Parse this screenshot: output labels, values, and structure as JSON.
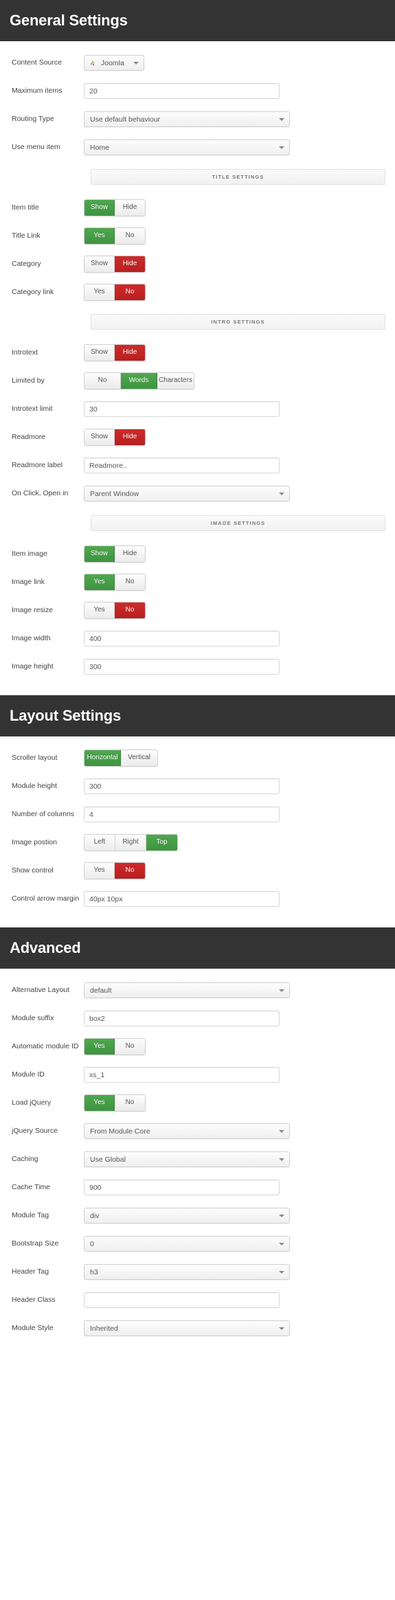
{
  "sections": [
    {
      "title": "General Settings",
      "rows": [
        {
          "kind": "select-joomla",
          "label": "Content Source",
          "value": "Joomla",
          "icon": "joomla-icon",
          "width": "88"
        },
        {
          "kind": "input",
          "label": "Maximum items",
          "value": "20",
          "width": "wide"
        },
        {
          "kind": "select",
          "label": "Routing Type",
          "value": "Use default behaviour",
          "width": "mid"
        },
        {
          "kind": "select",
          "label": "Use menu item",
          "value": "Home",
          "width": "mid"
        },
        {
          "kind": "subhead",
          "label": "TITLE SETTINGS"
        },
        {
          "kind": "toggle",
          "label": "Item title",
          "options": [
            "Show",
            "Hide"
          ],
          "selected": 0,
          "state": "green"
        },
        {
          "kind": "toggle",
          "label": "Title Link",
          "options": [
            "Yes",
            "No"
          ],
          "selected": 0,
          "state": "green"
        },
        {
          "kind": "toggle",
          "label": "Category",
          "options": [
            "Show",
            "Hide"
          ],
          "selected": 1,
          "state": "red"
        },
        {
          "kind": "toggle",
          "label": "Category link",
          "options": [
            "Yes",
            "No"
          ],
          "selected": 1,
          "state": "red"
        },
        {
          "kind": "subhead",
          "label": "INTRO SETTINGS"
        },
        {
          "kind": "toggle",
          "label": "Introtext",
          "options": [
            "Show",
            "Hide"
          ],
          "selected": 1,
          "state": "red"
        },
        {
          "kind": "toggle3",
          "label": "Limited by",
          "options": [
            "No",
            "Words",
            "Characters"
          ],
          "selected": 1,
          "state": "green"
        },
        {
          "kind": "input",
          "label": "Introtext limit",
          "value": "30",
          "width": "wide"
        },
        {
          "kind": "toggle",
          "label": "Readmore",
          "options": [
            "Show",
            "Hide"
          ],
          "selected": 1,
          "state": "red"
        },
        {
          "kind": "input",
          "label": "Readmore label",
          "value": "Readmore..",
          "width": "wide"
        },
        {
          "kind": "select",
          "label": "On Click, Open in",
          "value": "Parent Window",
          "width": "mid"
        },
        {
          "kind": "subhead",
          "label": "IMAGE SETTINGS"
        },
        {
          "kind": "toggle",
          "label": "Item image",
          "options": [
            "Show",
            "Hide"
          ],
          "selected": 0,
          "state": "green"
        },
        {
          "kind": "toggle",
          "label": "Image link",
          "options": [
            "Yes",
            "No"
          ],
          "selected": 0,
          "state": "green"
        },
        {
          "kind": "toggle",
          "label": "Image resize",
          "options": [
            "Yes",
            "No"
          ],
          "selected": 1,
          "state": "red"
        },
        {
          "kind": "input",
          "label": "Image width",
          "value": "400",
          "width": "wide"
        },
        {
          "kind": "input",
          "label": "Image height",
          "value": "300",
          "width": "wide"
        }
      ]
    },
    {
      "title": "Layout Settings",
      "rows": [
        {
          "kind": "toggle2w",
          "label": "Scroller layout",
          "options": [
            "Horizontal",
            "Vertical"
          ],
          "selected": 0,
          "state": "green"
        },
        {
          "kind": "input",
          "label": "Module height",
          "value": "300",
          "width": "wide"
        },
        {
          "kind": "input",
          "label": "Number of columns",
          "value": "4",
          "width": "wide"
        },
        {
          "kind": "toggle3p",
          "label": "Image postion",
          "options": [
            "Left",
            "Right",
            "Top"
          ],
          "selected": 2,
          "state": "green"
        },
        {
          "kind": "toggle",
          "label": "Show control",
          "options": [
            "Yes",
            "No"
          ],
          "selected": 1,
          "state": "red"
        },
        {
          "kind": "input",
          "label": "Control arrow margin",
          "value": "40px 10px",
          "width": "wide"
        }
      ]
    },
    {
      "title": "Advanced",
      "rows": [
        {
          "kind": "select",
          "label": "Alternative Layout",
          "value": "default",
          "width": "mid"
        },
        {
          "kind": "input",
          "label": "Module suffix",
          "value": "box2",
          "width": "wide"
        },
        {
          "kind": "toggle",
          "label": "Automatic module ID",
          "options": [
            "Yes",
            "No"
          ],
          "selected": 0,
          "state": "green"
        },
        {
          "kind": "input",
          "label": "Module ID",
          "value": "xs_1",
          "width": "wide"
        },
        {
          "kind": "toggle",
          "label": "Load jQuery",
          "options": [
            "Yes",
            "No"
          ],
          "selected": 0,
          "state": "green"
        },
        {
          "kind": "select",
          "label": "jQuery Source",
          "value": "From Module Core",
          "width": "mid"
        },
        {
          "kind": "select",
          "label": "Caching",
          "value": "Use Global",
          "width": "mid"
        },
        {
          "kind": "input",
          "label": "Cache Time",
          "value": "900",
          "width": "wide"
        },
        {
          "kind": "select",
          "label": "Module Tag",
          "value": "div",
          "width": "mid"
        },
        {
          "kind": "select",
          "label": "Bootstrap Size",
          "value": "0",
          "width": "mid"
        },
        {
          "kind": "select",
          "label": "Header Tag",
          "value": "h3",
          "width": "mid"
        },
        {
          "kind": "input",
          "label": "Header Class",
          "value": "",
          "width": "wide"
        },
        {
          "kind": "select",
          "label": "Module Style",
          "value": "Inherited",
          "width": "mid"
        }
      ]
    }
  ],
  "colors": {
    "banner_bg": "#333333",
    "accent_green": "#3e9440",
    "accent_red": "#bf2222",
    "subhead_text": "#777777"
  }
}
